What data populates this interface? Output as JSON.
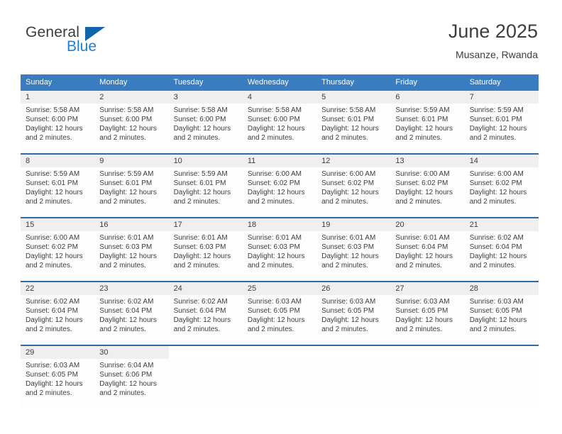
{
  "brand": {
    "name_top": "General",
    "name_bottom": "Blue",
    "triangle_color": "#1464ad",
    "blue_color": "#1f7fd4"
  },
  "header": {
    "title": "June 2025",
    "subtitle": "Musanze, Rwanda"
  },
  "theme": {
    "header_blue": "#3a7cc0",
    "divider_blue": "#2b6ca8",
    "date_band": "#efefef",
    "text": "#3d3d3d"
  },
  "weekdays": [
    "Sunday",
    "Monday",
    "Tuesday",
    "Wednesday",
    "Thursday",
    "Friday",
    "Saturday"
  ],
  "weeks": [
    {
      "days": [
        {
          "date": "1",
          "sunrise": "Sunrise: 5:58 AM",
          "sunset": "Sunset: 6:00 PM",
          "daylight1": "Daylight: 12 hours",
          "daylight2": "and 2 minutes."
        },
        {
          "date": "2",
          "sunrise": "Sunrise: 5:58 AM",
          "sunset": "Sunset: 6:00 PM",
          "daylight1": "Daylight: 12 hours",
          "daylight2": "and 2 minutes."
        },
        {
          "date": "3",
          "sunrise": "Sunrise: 5:58 AM",
          "sunset": "Sunset: 6:00 PM",
          "daylight1": "Daylight: 12 hours",
          "daylight2": "and 2 minutes."
        },
        {
          "date": "4",
          "sunrise": "Sunrise: 5:58 AM",
          "sunset": "Sunset: 6:00 PM",
          "daylight1": "Daylight: 12 hours",
          "daylight2": "and 2 minutes."
        },
        {
          "date": "5",
          "sunrise": "Sunrise: 5:58 AM",
          "sunset": "Sunset: 6:01 PM",
          "daylight1": "Daylight: 12 hours",
          "daylight2": "and 2 minutes."
        },
        {
          "date": "6",
          "sunrise": "Sunrise: 5:59 AM",
          "sunset": "Sunset: 6:01 PM",
          "daylight1": "Daylight: 12 hours",
          "daylight2": "and 2 minutes."
        },
        {
          "date": "7",
          "sunrise": "Sunrise: 5:59 AM",
          "sunset": "Sunset: 6:01 PM",
          "daylight1": "Daylight: 12 hours",
          "daylight2": "and 2 minutes."
        }
      ]
    },
    {
      "days": [
        {
          "date": "8",
          "sunrise": "Sunrise: 5:59 AM",
          "sunset": "Sunset: 6:01 PM",
          "daylight1": "Daylight: 12 hours",
          "daylight2": "and 2 minutes."
        },
        {
          "date": "9",
          "sunrise": "Sunrise: 5:59 AM",
          "sunset": "Sunset: 6:01 PM",
          "daylight1": "Daylight: 12 hours",
          "daylight2": "and 2 minutes."
        },
        {
          "date": "10",
          "sunrise": "Sunrise: 5:59 AM",
          "sunset": "Sunset: 6:01 PM",
          "daylight1": "Daylight: 12 hours",
          "daylight2": "and 2 minutes."
        },
        {
          "date": "11",
          "sunrise": "Sunrise: 6:00 AM",
          "sunset": "Sunset: 6:02 PM",
          "daylight1": "Daylight: 12 hours",
          "daylight2": "and 2 minutes."
        },
        {
          "date": "12",
          "sunrise": "Sunrise: 6:00 AM",
          "sunset": "Sunset: 6:02 PM",
          "daylight1": "Daylight: 12 hours",
          "daylight2": "and 2 minutes."
        },
        {
          "date": "13",
          "sunrise": "Sunrise: 6:00 AM",
          "sunset": "Sunset: 6:02 PM",
          "daylight1": "Daylight: 12 hours",
          "daylight2": "and 2 minutes."
        },
        {
          "date": "14",
          "sunrise": "Sunrise: 6:00 AM",
          "sunset": "Sunset: 6:02 PM",
          "daylight1": "Daylight: 12 hours",
          "daylight2": "and 2 minutes."
        }
      ]
    },
    {
      "days": [
        {
          "date": "15",
          "sunrise": "Sunrise: 6:00 AM",
          "sunset": "Sunset: 6:02 PM",
          "daylight1": "Daylight: 12 hours",
          "daylight2": "and 2 minutes."
        },
        {
          "date": "16",
          "sunrise": "Sunrise: 6:01 AM",
          "sunset": "Sunset: 6:03 PM",
          "daylight1": "Daylight: 12 hours",
          "daylight2": "and 2 minutes."
        },
        {
          "date": "17",
          "sunrise": "Sunrise: 6:01 AM",
          "sunset": "Sunset: 6:03 PM",
          "daylight1": "Daylight: 12 hours",
          "daylight2": "and 2 minutes."
        },
        {
          "date": "18",
          "sunrise": "Sunrise: 6:01 AM",
          "sunset": "Sunset: 6:03 PM",
          "daylight1": "Daylight: 12 hours",
          "daylight2": "and 2 minutes."
        },
        {
          "date": "19",
          "sunrise": "Sunrise: 6:01 AM",
          "sunset": "Sunset: 6:03 PM",
          "daylight1": "Daylight: 12 hours",
          "daylight2": "and 2 minutes."
        },
        {
          "date": "20",
          "sunrise": "Sunrise: 6:01 AM",
          "sunset": "Sunset: 6:04 PM",
          "daylight1": "Daylight: 12 hours",
          "daylight2": "and 2 minutes."
        },
        {
          "date": "21",
          "sunrise": "Sunrise: 6:02 AM",
          "sunset": "Sunset: 6:04 PM",
          "daylight1": "Daylight: 12 hours",
          "daylight2": "and 2 minutes."
        }
      ]
    },
    {
      "days": [
        {
          "date": "22",
          "sunrise": "Sunrise: 6:02 AM",
          "sunset": "Sunset: 6:04 PM",
          "daylight1": "Daylight: 12 hours",
          "daylight2": "and 2 minutes."
        },
        {
          "date": "23",
          "sunrise": "Sunrise: 6:02 AM",
          "sunset": "Sunset: 6:04 PM",
          "daylight1": "Daylight: 12 hours",
          "daylight2": "and 2 minutes."
        },
        {
          "date": "24",
          "sunrise": "Sunrise: 6:02 AM",
          "sunset": "Sunset: 6:04 PM",
          "daylight1": "Daylight: 12 hours",
          "daylight2": "and 2 minutes."
        },
        {
          "date": "25",
          "sunrise": "Sunrise: 6:03 AM",
          "sunset": "Sunset: 6:05 PM",
          "daylight1": "Daylight: 12 hours",
          "daylight2": "and 2 minutes."
        },
        {
          "date": "26",
          "sunrise": "Sunrise: 6:03 AM",
          "sunset": "Sunset: 6:05 PM",
          "daylight1": "Daylight: 12 hours",
          "daylight2": "and 2 minutes."
        },
        {
          "date": "27",
          "sunrise": "Sunrise: 6:03 AM",
          "sunset": "Sunset: 6:05 PM",
          "daylight1": "Daylight: 12 hours",
          "daylight2": "and 2 minutes."
        },
        {
          "date": "28",
          "sunrise": "Sunrise: 6:03 AM",
          "sunset": "Sunset: 6:05 PM",
          "daylight1": "Daylight: 12 hours",
          "daylight2": "and 2 minutes."
        }
      ]
    },
    {
      "days": [
        {
          "date": "29",
          "sunrise": "Sunrise: 6:03 AM",
          "sunset": "Sunset: 6:05 PM",
          "daylight1": "Daylight: 12 hours",
          "daylight2": "and 2 minutes."
        },
        {
          "date": "30",
          "sunrise": "Sunrise: 6:04 AM",
          "sunset": "Sunset: 6:06 PM",
          "daylight1": "Daylight: 12 hours",
          "daylight2": "and 2 minutes."
        },
        {
          "date": "",
          "sunrise": "",
          "sunset": "",
          "daylight1": "",
          "daylight2": ""
        },
        {
          "date": "",
          "sunrise": "",
          "sunset": "",
          "daylight1": "",
          "daylight2": ""
        },
        {
          "date": "",
          "sunrise": "",
          "sunset": "",
          "daylight1": "",
          "daylight2": ""
        },
        {
          "date": "",
          "sunrise": "",
          "sunset": "",
          "daylight1": "",
          "daylight2": ""
        },
        {
          "date": "",
          "sunrise": "",
          "sunset": "",
          "daylight1": "",
          "daylight2": ""
        }
      ]
    }
  ]
}
